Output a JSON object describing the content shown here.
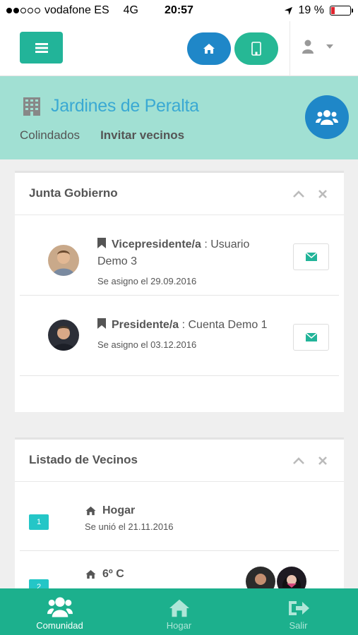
{
  "status": {
    "carrier": "vodafone ES",
    "network": "4G",
    "time": "20:57",
    "battery": "19 %",
    "battery_level": 0.19
  },
  "navbar": {
    "menu_icon": "hamburger-icon",
    "home_icon": "home-icon",
    "building_icon": "building-icon",
    "user_icon": "user-icon"
  },
  "community": {
    "name": "Jardines de Peralta",
    "links": [
      "Colindados",
      "Invitar vecinos"
    ]
  },
  "junta": {
    "title": "Junta Gobierno",
    "members": [
      {
        "role": "Vicepresidente/a",
        "sep": " : ",
        "name": "Usuario Demo 3",
        "date": "Se asigno el 29.09.2016"
      },
      {
        "role": "Presidente/a",
        "sep": " : ",
        "name": "Cuenta Demo 1",
        "date": "Se asigno el 03.12.2016"
      }
    ]
  },
  "vecinos": {
    "title": "Listado de Vecinos",
    "items": [
      {
        "num": "1",
        "name": "Hogar",
        "date": "Se unió el 21.11.2016"
      },
      {
        "num": "2",
        "name": "6º C",
        "date": ""
      }
    ]
  },
  "tabs": [
    {
      "label": "Comunidad",
      "icon": "users-icon"
    },
    {
      "label": "Hogar",
      "icon": "home-icon"
    },
    {
      "label": "Salir",
      "icon": "sign-out-icon"
    }
  ],
  "colors": {
    "accent_green": "#22b499",
    "accent_blue": "#1f87c8",
    "header_bg": "#a1e0d3",
    "tabbar": "#1cb08d"
  }
}
